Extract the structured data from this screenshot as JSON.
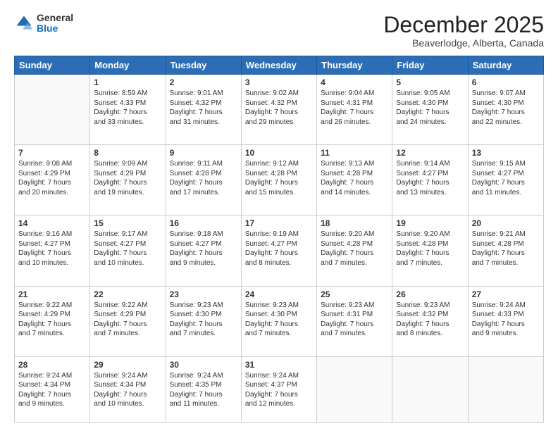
{
  "logo": {
    "general": "General",
    "blue": "Blue"
  },
  "header": {
    "month": "December 2025",
    "location": "Beaverlodge, Alberta, Canada"
  },
  "weekdays": [
    "Sunday",
    "Monday",
    "Tuesday",
    "Wednesday",
    "Thursday",
    "Friday",
    "Saturday"
  ],
  "weeks": [
    [
      {
        "day": "",
        "info": ""
      },
      {
        "day": "1",
        "info": "Sunrise: 8:59 AM\nSunset: 4:33 PM\nDaylight: 7 hours\nand 33 minutes."
      },
      {
        "day": "2",
        "info": "Sunrise: 9:01 AM\nSunset: 4:32 PM\nDaylight: 7 hours\nand 31 minutes."
      },
      {
        "day": "3",
        "info": "Sunrise: 9:02 AM\nSunset: 4:32 PM\nDaylight: 7 hours\nand 29 minutes."
      },
      {
        "day": "4",
        "info": "Sunrise: 9:04 AM\nSunset: 4:31 PM\nDaylight: 7 hours\nand 26 minutes."
      },
      {
        "day": "5",
        "info": "Sunrise: 9:05 AM\nSunset: 4:30 PM\nDaylight: 7 hours\nand 24 minutes."
      },
      {
        "day": "6",
        "info": "Sunrise: 9:07 AM\nSunset: 4:30 PM\nDaylight: 7 hours\nand 22 minutes."
      }
    ],
    [
      {
        "day": "7",
        "info": "Sunrise: 9:08 AM\nSunset: 4:29 PM\nDaylight: 7 hours\nand 20 minutes."
      },
      {
        "day": "8",
        "info": "Sunrise: 9:09 AM\nSunset: 4:29 PM\nDaylight: 7 hours\nand 19 minutes."
      },
      {
        "day": "9",
        "info": "Sunrise: 9:11 AM\nSunset: 4:28 PM\nDaylight: 7 hours\nand 17 minutes."
      },
      {
        "day": "10",
        "info": "Sunrise: 9:12 AM\nSunset: 4:28 PM\nDaylight: 7 hours\nand 15 minutes."
      },
      {
        "day": "11",
        "info": "Sunrise: 9:13 AM\nSunset: 4:28 PM\nDaylight: 7 hours\nand 14 minutes."
      },
      {
        "day": "12",
        "info": "Sunrise: 9:14 AM\nSunset: 4:27 PM\nDaylight: 7 hours\nand 13 minutes."
      },
      {
        "day": "13",
        "info": "Sunrise: 9:15 AM\nSunset: 4:27 PM\nDaylight: 7 hours\nand 11 minutes."
      }
    ],
    [
      {
        "day": "14",
        "info": "Sunrise: 9:16 AM\nSunset: 4:27 PM\nDaylight: 7 hours\nand 10 minutes."
      },
      {
        "day": "15",
        "info": "Sunrise: 9:17 AM\nSunset: 4:27 PM\nDaylight: 7 hours\nand 10 minutes."
      },
      {
        "day": "16",
        "info": "Sunrise: 9:18 AM\nSunset: 4:27 PM\nDaylight: 7 hours\nand 9 minutes."
      },
      {
        "day": "17",
        "info": "Sunrise: 9:19 AM\nSunset: 4:27 PM\nDaylight: 7 hours\nand 8 minutes."
      },
      {
        "day": "18",
        "info": "Sunrise: 9:20 AM\nSunset: 4:28 PM\nDaylight: 7 hours\nand 7 minutes."
      },
      {
        "day": "19",
        "info": "Sunrise: 9:20 AM\nSunset: 4:28 PM\nDaylight: 7 hours\nand 7 minutes."
      },
      {
        "day": "20",
        "info": "Sunrise: 9:21 AM\nSunset: 4:28 PM\nDaylight: 7 hours\nand 7 minutes."
      }
    ],
    [
      {
        "day": "21",
        "info": "Sunrise: 9:22 AM\nSunset: 4:29 PM\nDaylight: 7 hours\nand 7 minutes."
      },
      {
        "day": "22",
        "info": "Sunrise: 9:22 AM\nSunset: 4:29 PM\nDaylight: 7 hours\nand 7 minutes."
      },
      {
        "day": "23",
        "info": "Sunrise: 9:23 AM\nSunset: 4:30 PM\nDaylight: 7 hours\nand 7 minutes."
      },
      {
        "day": "24",
        "info": "Sunrise: 9:23 AM\nSunset: 4:30 PM\nDaylight: 7 hours\nand 7 minutes."
      },
      {
        "day": "25",
        "info": "Sunrise: 9:23 AM\nSunset: 4:31 PM\nDaylight: 7 hours\nand 7 minutes."
      },
      {
        "day": "26",
        "info": "Sunrise: 9:23 AM\nSunset: 4:32 PM\nDaylight: 7 hours\nand 8 minutes."
      },
      {
        "day": "27",
        "info": "Sunrise: 9:24 AM\nSunset: 4:33 PM\nDaylight: 7 hours\nand 9 minutes."
      }
    ],
    [
      {
        "day": "28",
        "info": "Sunrise: 9:24 AM\nSunset: 4:34 PM\nDaylight: 7 hours\nand 9 minutes."
      },
      {
        "day": "29",
        "info": "Sunrise: 9:24 AM\nSunset: 4:34 PM\nDaylight: 7 hours\nand 10 minutes."
      },
      {
        "day": "30",
        "info": "Sunrise: 9:24 AM\nSunset: 4:35 PM\nDaylight: 7 hours\nand 11 minutes."
      },
      {
        "day": "31",
        "info": "Sunrise: 9:24 AM\nSunset: 4:37 PM\nDaylight: 7 hours\nand 12 minutes."
      },
      {
        "day": "",
        "info": ""
      },
      {
        "day": "",
        "info": ""
      },
      {
        "day": "",
        "info": ""
      }
    ]
  ]
}
